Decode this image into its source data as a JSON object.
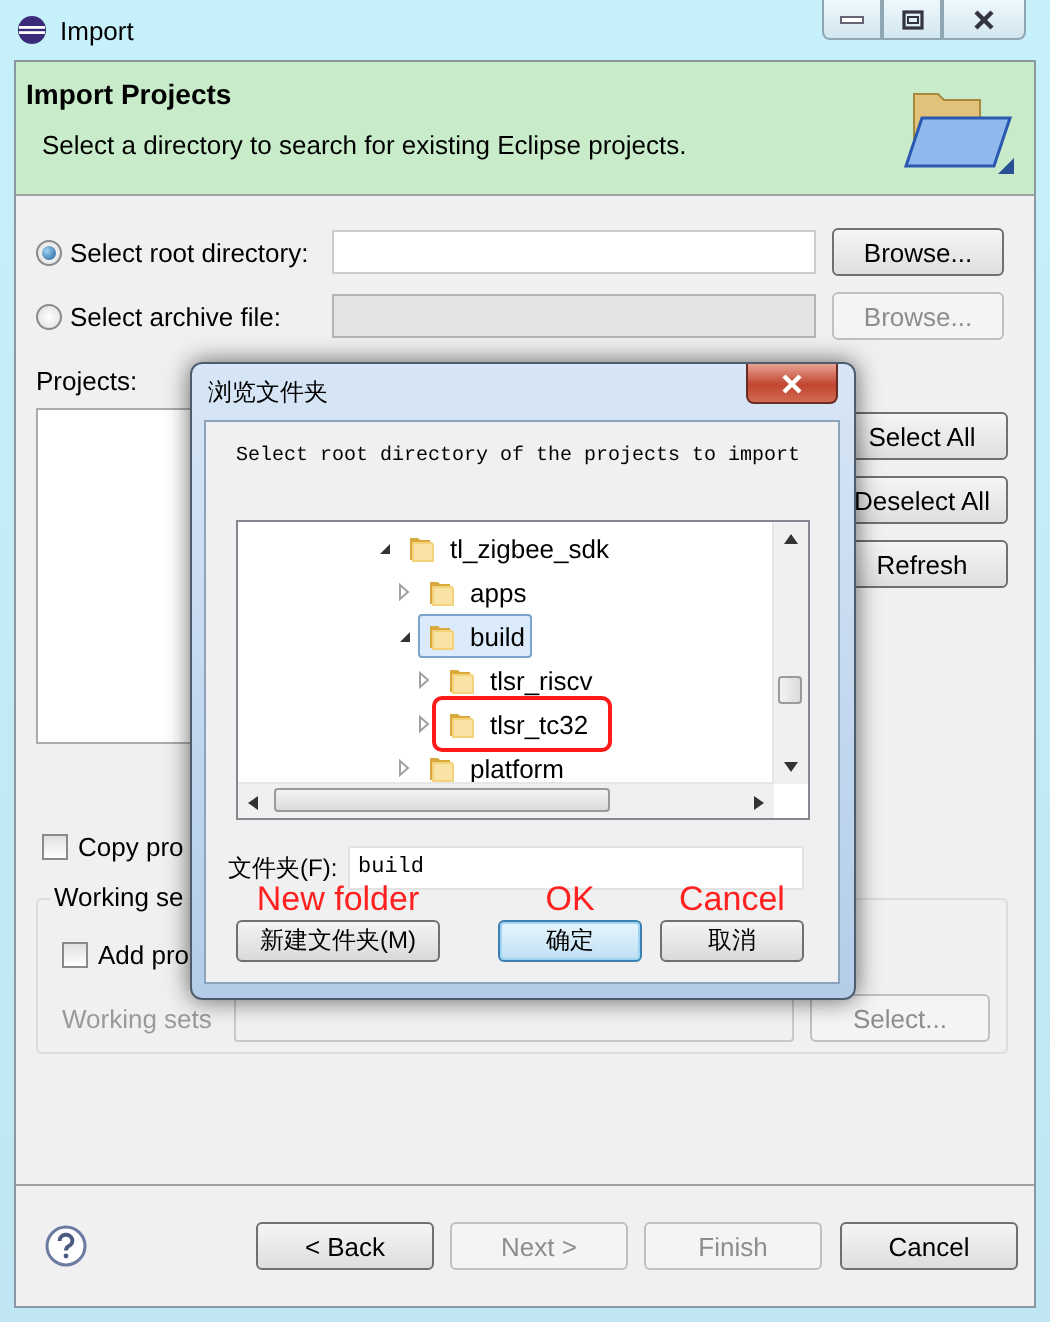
{
  "window": {
    "title": "Import"
  },
  "header": {
    "title": "Import Projects",
    "description": "Select a directory to search for existing Eclipse projects."
  },
  "source_options": [
    {
      "label": "Select root directory:",
      "selected": true,
      "disabled": false,
      "button": "Browse..."
    },
    {
      "label": "Select archive file:",
      "selected": false,
      "disabled": true,
      "button": "Browse..."
    }
  ],
  "projects": {
    "label": "Projects:",
    "buttons": [
      "Select All",
      "Deselect All",
      "Refresh"
    ]
  },
  "copy_checkbox": {
    "label": "Copy pro",
    "checked": false
  },
  "working_sets": {
    "legend": "Working se",
    "add_checkbox": {
      "label": "Add pro",
      "checked": false
    },
    "label": "Working sets",
    "button": "Select...",
    "disabled": true
  },
  "footer_buttons": [
    {
      "label": "< Back",
      "disabled": false
    },
    {
      "label": "Next >",
      "disabled": true
    },
    {
      "label": "Finish",
      "disabled": true
    },
    {
      "label": "Cancel",
      "disabled": false
    }
  ],
  "dialog": {
    "title": "浏览文件夹",
    "prompt": "Select root directory of the projects to import",
    "tree": [
      {
        "label": "tl_zigbee_sdk",
        "expanded": true,
        "selected": false,
        "highlighted": false,
        "children": [
          {
            "label": "apps",
            "expanded": false,
            "selected": false,
            "highlighted": false
          },
          {
            "label": "build",
            "expanded": true,
            "selected": true,
            "highlighted": false,
            "children": [
              {
                "label": "tlsr_riscv",
                "expanded": false,
                "selected": false,
                "highlighted": false
              },
              {
                "label": "tlsr_tc32",
                "expanded": false,
                "selected": false,
                "highlighted": true
              }
            ]
          },
          {
            "label": "platform",
            "expanded": false,
            "selected": false,
            "highlighted": false
          }
        ]
      }
    ],
    "folder_label": "文件夹(F):",
    "folder_value": "build",
    "buttons": [
      {
        "label": "新建文件夹(M)",
        "annotation": "New folder",
        "default": false
      },
      {
        "label": "确定",
        "annotation": "OK",
        "default": true
      },
      {
        "label": "取消",
        "annotation": "Cancel",
        "default": false
      }
    ]
  }
}
